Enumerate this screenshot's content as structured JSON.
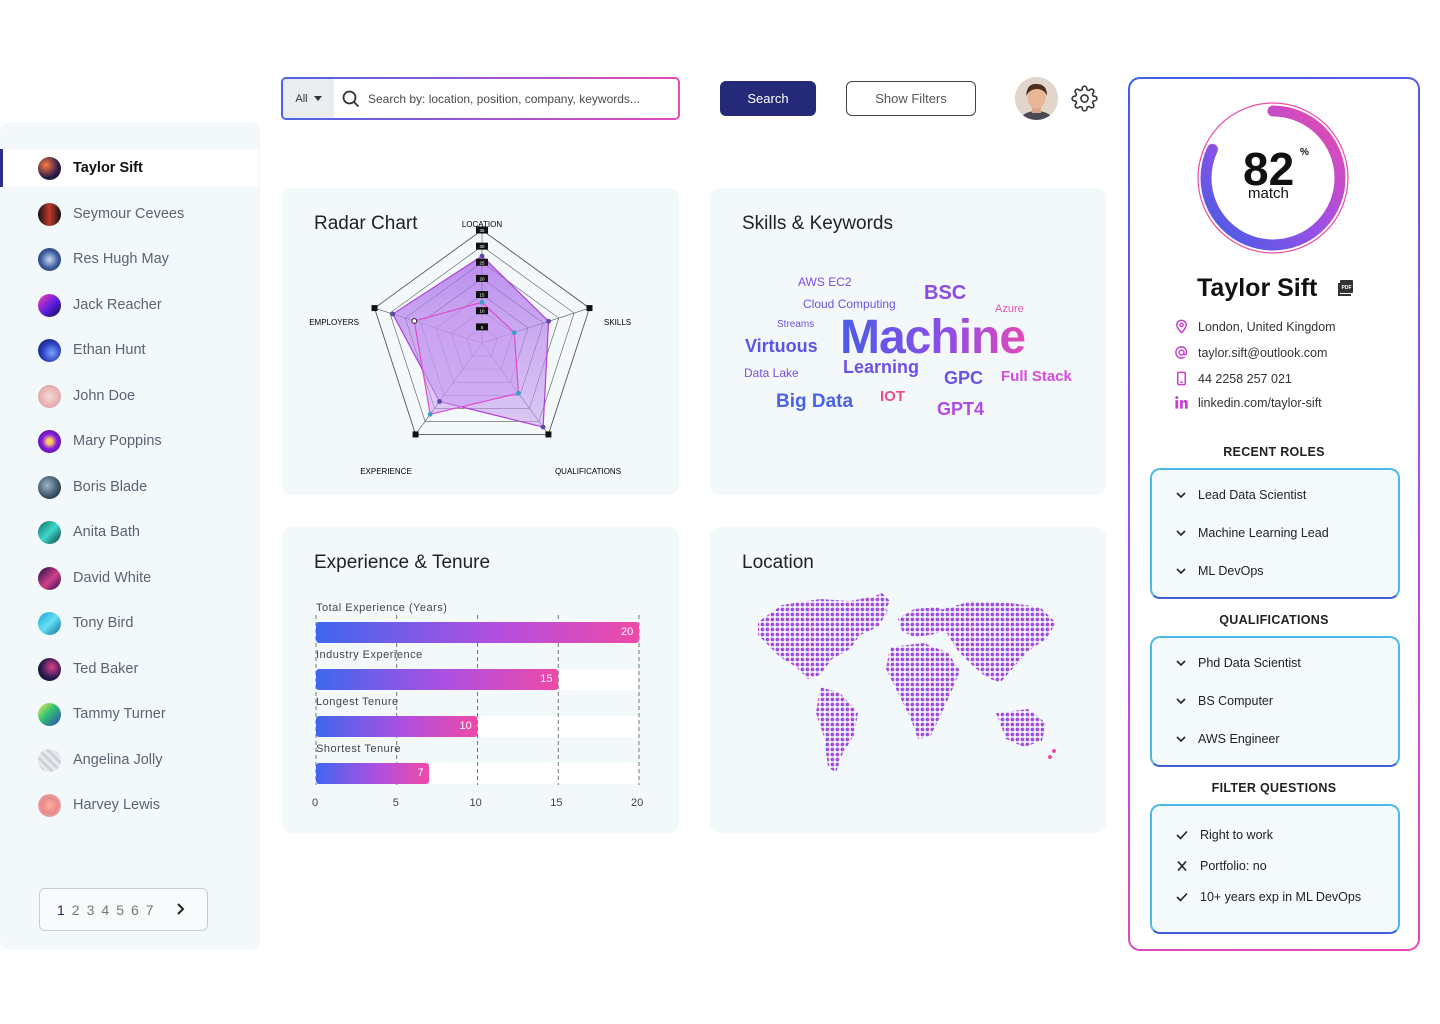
{
  "search": {
    "scope": "All",
    "placeholder": "Search by: location, position, company, keywords...",
    "search_label": "Search",
    "filters_label": "Show Filters"
  },
  "candidates": [
    {
      "name": "Taylor Sift",
      "active": true
    },
    {
      "name": "Seymour Cevees"
    },
    {
      "name": "Res Hugh May"
    },
    {
      "name": "Jack Reacher"
    },
    {
      "name": "Ethan Hunt"
    },
    {
      "name": "John Doe"
    },
    {
      "name": "Mary Poppins"
    },
    {
      "name": "Boris Blade"
    },
    {
      "name": "Anita Bath"
    },
    {
      "name": "David White"
    },
    {
      "name": "Tony Bird"
    },
    {
      "name": "Ted Baker"
    },
    {
      "name": "Tammy Turner"
    },
    {
      "name": "Angelina Jolly"
    },
    {
      "name": "Harvey Lewis"
    }
  ],
  "pagination": {
    "pages": [
      "1",
      "2",
      "3",
      "4",
      "5",
      "6",
      "7"
    ],
    "current": "1"
  },
  "cards": {
    "radar_title": "Radar Chart",
    "skills_title": "Skills & Keywords",
    "experience_title": "Experience & Tenure",
    "location_title": "Location"
  },
  "radar": {
    "axes": [
      "LOCATION",
      "SKILLS",
      "QUALIFICATIONS",
      "EXPERIENCE",
      "EMPLOYERS"
    ],
    "scale": [
      "35",
      "30",
      "25",
      "20",
      "15",
      "10",
      "5"
    ]
  },
  "chart_data": {
    "type": "bar",
    "title": "Experience & Tenure",
    "categories": [
      "Total Experience (Years)",
      "Industry Experience",
      "Longest Tenure",
      "Shortest Tenure"
    ],
    "values": [
      20,
      15,
      10,
      7
    ],
    "xlim": [
      0,
      20
    ],
    "xticks": [
      "0",
      "5",
      "10",
      "15",
      "20"
    ]
  },
  "skills": [
    {
      "text": "AWS EC2",
      "color": "#7b4be6"
    },
    {
      "text": "BSC",
      "color": "#8a4be6"
    },
    {
      "text": "Cloud Computing",
      "color": "#6a52e6"
    },
    {
      "text": "Azure",
      "color": "#e854b8"
    },
    {
      "text": "Streams",
      "color": "#6a52e6"
    },
    {
      "text": "Machine",
      "color": "#6a4fe6"
    },
    {
      "text": "Virtuous",
      "color": "#5a55e6"
    },
    {
      "text": "Learning",
      "color": "#6f50e6"
    },
    {
      "text": "Data Lake",
      "color": "#7b4be6"
    },
    {
      "text": "GPC",
      "color": "#6a52e6"
    },
    {
      "text": "Full Stack",
      "color": "#d84be0"
    },
    {
      "text": "Big Data",
      "color": "#4a62e6"
    },
    {
      "text": "IOT",
      "color": "#e84a8a"
    },
    {
      "text": "GPT4",
      "color": "#b14be6"
    }
  ],
  "profile": {
    "match_value": "82",
    "match_percent": 0.82,
    "match_symbol": "%",
    "match_label": "match",
    "name": "Taylor Sift",
    "location": "London, United Kingdom",
    "email": "taylor.sift@outlook.com",
    "phone": "44 2258 257 021",
    "linkedin": "linkedin.com/taylor-sift",
    "recent_roles_title": "RECENT ROLES",
    "recent_roles": [
      "Lead Data Scientist",
      "Machine Learning Lead",
      "ML DevOps"
    ],
    "qualifications_title": "QUALIFICATIONS",
    "qualifications": [
      "Phd Data Scientist",
      "BS Computer",
      "AWS Engineer"
    ],
    "filter_questions_title": "FILTER QUESTIONS",
    "filter_questions": [
      {
        "text": "Right to work",
        "status": "check"
      },
      {
        "text": "Portfolio: no",
        "status": "cross"
      },
      {
        "text": "10+ years exp in ML DevOps",
        "status": "check"
      }
    ]
  }
}
